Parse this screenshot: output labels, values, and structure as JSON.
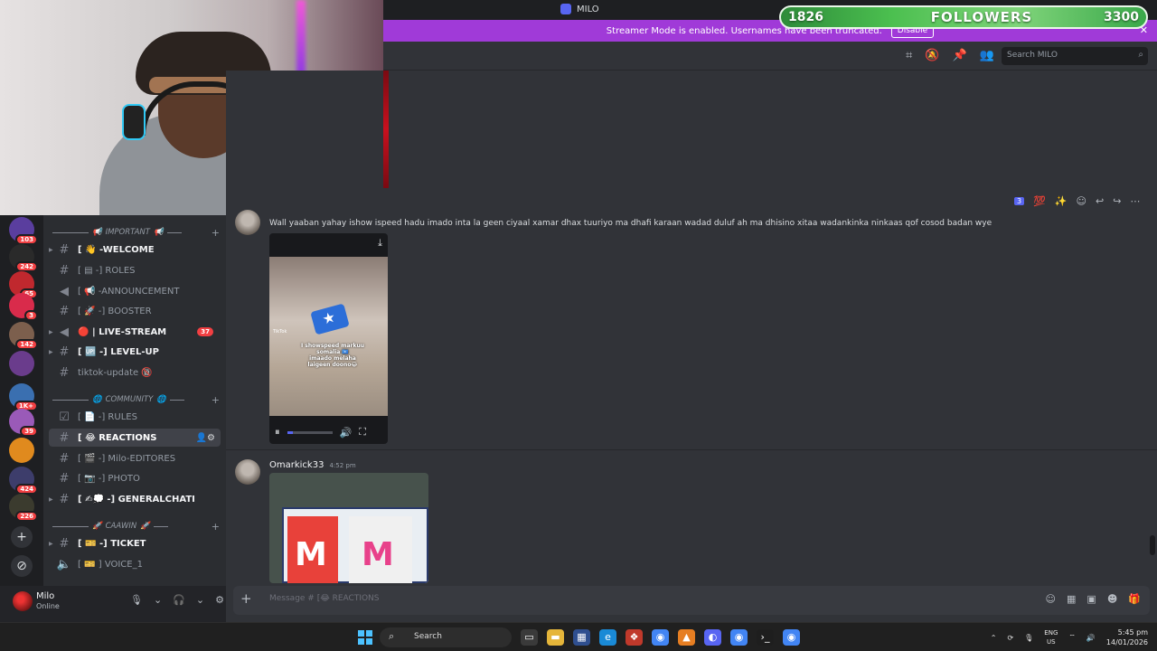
{
  "window": {
    "title": "MILO",
    "controls": [
      "—",
      "▢",
      "?",
      "✕"
    ]
  },
  "banner": {
    "text": "Streamer Mode is enabled. Usernames have been truncated.",
    "disable_label": "Disable",
    "close": "✕"
  },
  "followers_overlay": {
    "current": "1826",
    "label": "FOLLOWERS",
    "goal": "3300",
    "progress_fraction": 0.55
  },
  "toolbar": {
    "search_placeholder": "Search MILO",
    "icons": [
      "threads-icon",
      "mute-icon",
      "pin-icon",
      "members-icon"
    ]
  },
  "servers": [
    {
      "badge": "103"
    },
    {
      "badge": "242"
    },
    {
      "badge": "65"
    },
    {
      "badge": "3"
    },
    {
      "badge": "142"
    },
    {
      "badge": ""
    },
    {
      "badge": "1K+"
    },
    {
      "badge": "39"
    },
    {
      "badge": ""
    },
    {
      "badge": "424"
    },
    {
      "badge": "226"
    }
  ],
  "channels": {
    "categories": [
      {
        "label": "IMPORTANT"
      },
      {
        "label": "COMMUNITY"
      },
      {
        "label": "CAAWIN"
      }
    ],
    "items": [
      {
        "prefix": "[ ",
        "emoji": "👋",
        "label": "-WELCOME",
        "bold": true
      },
      {
        "prefix": "[ ",
        "emoji": "▤",
        "label": "-] ROLES"
      },
      {
        "prefix": "[ ",
        "emoji": "📢",
        "label": "-ANNOUNCEMENT"
      },
      {
        "prefix": "[ ",
        "emoji": "🚀",
        "label": "-] BOOSTER"
      },
      {
        "prefix": "",
        "emoji": "🔴",
        "label": "| LIVE-STREAM",
        "bold": true,
        "count": "37"
      },
      {
        "prefix": "[ ",
        "emoji": "🆙",
        "label": "-] LEVEL-UP",
        "bold": true
      },
      {
        "prefix": "",
        "emoji": "",
        "label": "tiktok-update 🔞"
      },
      {
        "prefix": "[ ",
        "emoji": "📄",
        "label": "-] RULES"
      },
      {
        "prefix": "[ ",
        "emoji": "😂",
        "label": "REACTIONS"
      },
      {
        "prefix": "[ ",
        "emoji": "🎬",
        "label": "-] Milo-EDITORES"
      },
      {
        "prefix": "[ ",
        "emoji": "📷",
        "label": "-] PHOTO"
      },
      {
        "prefix": "[ ",
        "emoji": "✍💭",
        "label": "-] GENERALCHATI",
        "bold": true
      },
      {
        "prefix": "[ ",
        "emoji": "🎫",
        "label": "-] TICKET",
        "bold": true
      },
      {
        "prefix": "[ ",
        "emoji": "🎫",
        "label": "] VOICE_1"
      }
    ]
  },
  "user": {
    "name": "Milo",
    "status": "Online"
  },
  "messages": {
    "first_text": "Wall yaaban yahay ishow ispeed hadu imado inta la geen ciyaal xamar dhax tuuriyo ma dhafi karaan wadad duluf ah ma dhisino xitaa wadankinka ninkaas qof cosod badan wye",
    "video_caption": "I showspeed markuu\nsomalia 🇸🇴\nimaado melaha\nlaigeen doono😂",
    "video_watermark": "TikTok",
    "second_author": "Omarkick33",
    "second_time": "4:52 pm",
    "hover_count": "3"
  },
  "composer": {
    "placeholder": "Message # [😂 REACTIONS"
  },
  "taskbar": {
    "search_label": "Search",
    "lang_top": "ENG",
    "lang_bottom": "US",
    "time": "5:45 pm",
    "date": "14/01/2026"
  }
}
